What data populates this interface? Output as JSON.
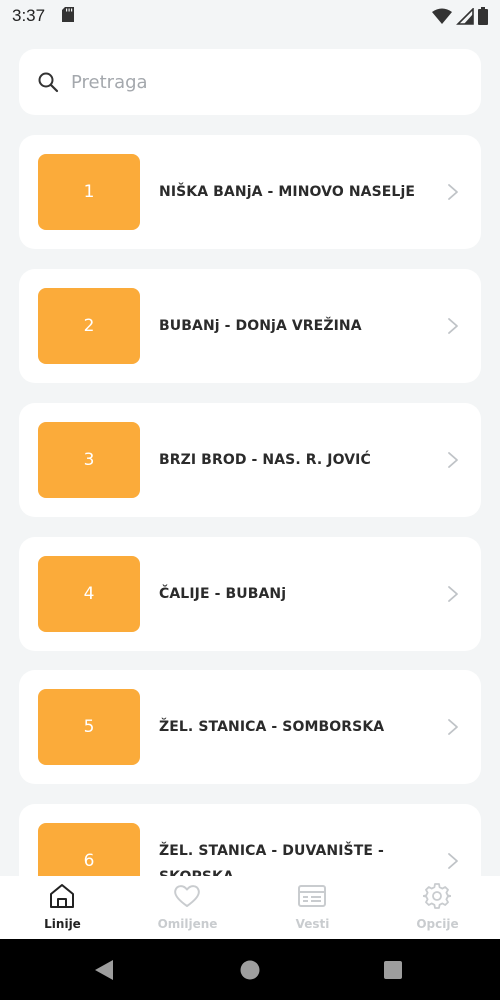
{
  "status_bar": {
    "time": "3:37",
    "icons": [
      "sd-card-icon",
      "wifi-icon",
      "signal-icon",
      "battery-icon"
    ]
  },
  "search": {
    "placeholder": "Pretraga",
    "value": ""
  },
  "lines": [
    {
      "number": "1",
      "name": "NIŠKA BANjA - MINOVO NASELjE"
    },
    {
      "number": "2",
      "name": "BUBANj - DONjA VREŽINA"
    },
    {
      "number": "3",
      "name": "BRZI BROD - NAS. R. JOVIĆ"
    },
    {
      "number": "4",
      "name": "ČALIJE - BUBANj"
    },
    {
      "number": "5",
      "name": "ŽEL. STANICA - SOMBORSKA"
    },
    {
      "number": "6",
      "name": "ŽEL. STANICA - DUVANIŠTE - SKOPSKA"
    }
  ],
  "bottom_nav": {
    "items": [
      {
        "label": "Linije",
        "icon": "home-icon",
        "active": true
      },
      {
        "label": "Omiljene",
        "icon": "heart-icon",
        "active": false
      },
      {
        "label": "Vesti",
        "icon": "news-icon",
        "active": false
      },
      {
        "label": "Opcije",
        "icon": "gear-icon",
        "active": false
      }
    ]
  },
  "colors": {
    "accent": "#fbab3a",
    "background": "#f3f5f6",
    "card": "#ffffff",
    "nav_active": "#222222",
    "nav_inactive": "#c9cccf"
  }
}
